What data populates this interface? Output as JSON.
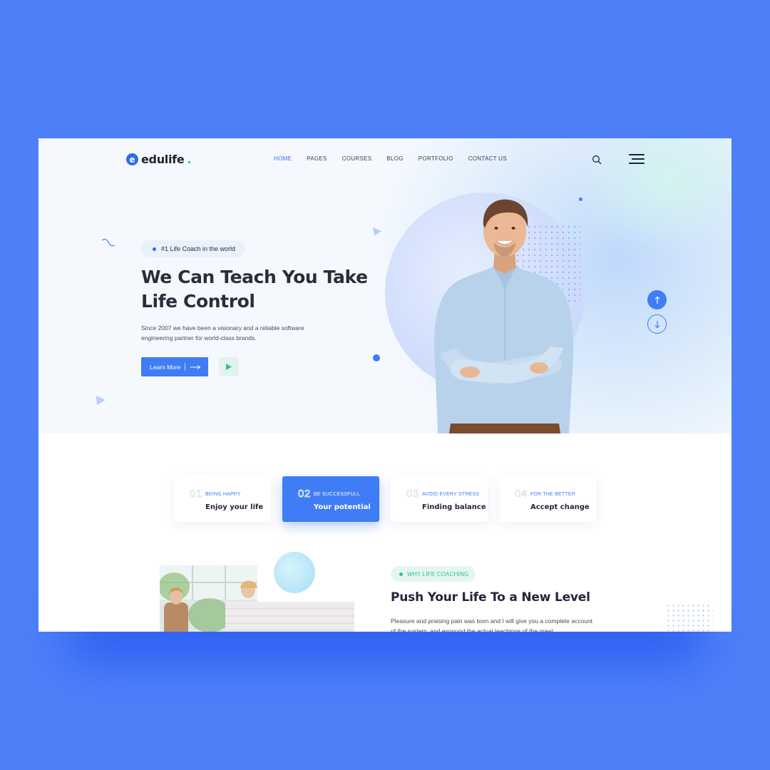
{
  "brand": {
    "name": "edulife",
    "mark": "e",
    "dot": "."
  },
  "nav": {
    "items": [
      "HOME",
      "PAGES",
      "COURSES",
      "BLOG",
      "PORTFOLIO",
      "CONTACT US"
    ],
    "active": "HOME"
  },
  "hero": {
    "badge": "#1 Life Coach in the world",
    "title": "We Can Teach You Take Life Control",
    "description": "Since 2007 we have been a visionary and a reliable software engineering partner for world-class brands.",
    "cta_label": "Learn More"
  },
  "features": [
    {
      "num": "01",
      "kicker": "BEING HAPPY",
      "title": "Enjoy your life"
    },
    {
      "num": "02",
      "kicker": "BE SUCCESSFULL",
      "title": "Your potential"
    },
    {
      "num": "03",
      "kicker": "AVOID EVERY STRESS",
      "title": "Finding balance"
    },
    {
      "num": "04",
      "kicker": "FOR THE BETTER",
      "title": "Accept change"
    }
  ],
  "active_feature": "02",
  "about": {
    "badge": "WHY LIFE COACHING",
    "title": "Push Your Life To a New Level",
    "description": "Pleasure and praising pain was born and I will give you a complete account of the system, and expound the actual teachings of the great"
  },
  "colors": {
    "background": "#4d7ff8",
    "accent": "#3f7cf5",
    "green": "#28c38a",
    "dark_text": "#23263a"
  },
  "icons": {
    "search": "search-icon",
    "menu": "hamburger-menu-icon",
    "play": "play-icon",
    "arrow_right": "arrow-right-icon",
    "scroll_up": "arrow-up-icon",
    "scroll_down": "arrow-down-icon"
  }
}
